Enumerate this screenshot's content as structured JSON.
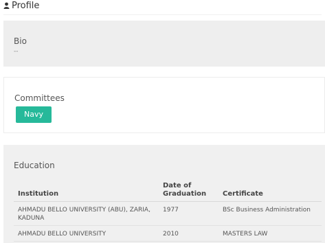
{
  "header": {
    "title": "Profile",
    "icon": "user-icon"
  },
  "bio": {
    "title": "Bio",
    "value": "--"
  },
  "committees": {
    "title": "Committees",
    "tags": [
      "Navy"
    ],
    "tag_color": "#26b99a"
  },
  "education": {
    "title": "Education",
    "columns": [
      "Institution",
      "Date of Graduation",
      "Certificate"
    ],
    "rows": [
      {
        "institution": "AHMADU BELLO UNIVERSITY (ABU), ZARIA, KADUNA",
        "date": "1977",
        "certificate": "BSc Business Administration"
      },
      {
        "institution": "AHMADU BELLO UNIVERSITY",
        "date": "2010",
        "certificate": "MASTERS LAW"
      }
    ]
  }
}
